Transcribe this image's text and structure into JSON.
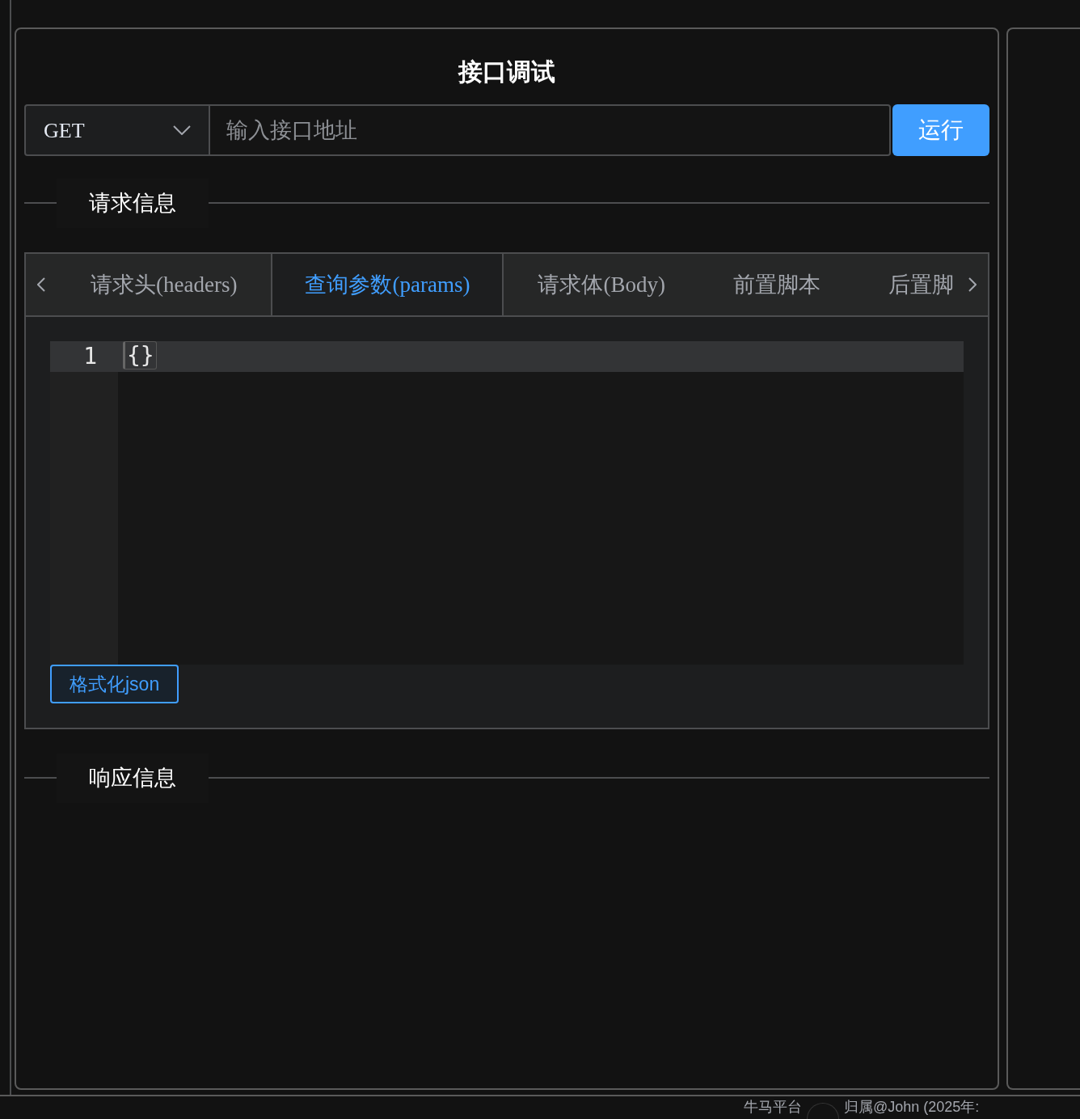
{
  "title": "接口调试",
  "request": {
    "method": "GET",
    "url_placeholder": "输入接口地址",
    "run_button": "运行"
  },
  "request_section": "请求信息",
  "tabs": [
    {
      "label": "请求头(headers)",
      "selected": false
    },
    {
      "label": "查询参数(params)",
      "selected": true
    },
    {
      "label": "请求体(Body)",
      "selected": false
    },
    {
      "label": "前置脚本",
      "selected": false
    },
    {
      "label": "后置脚",
      "selected": false
    }
  ],
  "editor": {
    "lines": [
      {
        "number": "1",
        "code": "{}"
      }
    ]
  },
  "format_button": "格式化json",
  "response_section": "响应信息",
  "footer": {
    "left": "牛马平台",
    "right": "归属@John (2025年:"
  }
}
